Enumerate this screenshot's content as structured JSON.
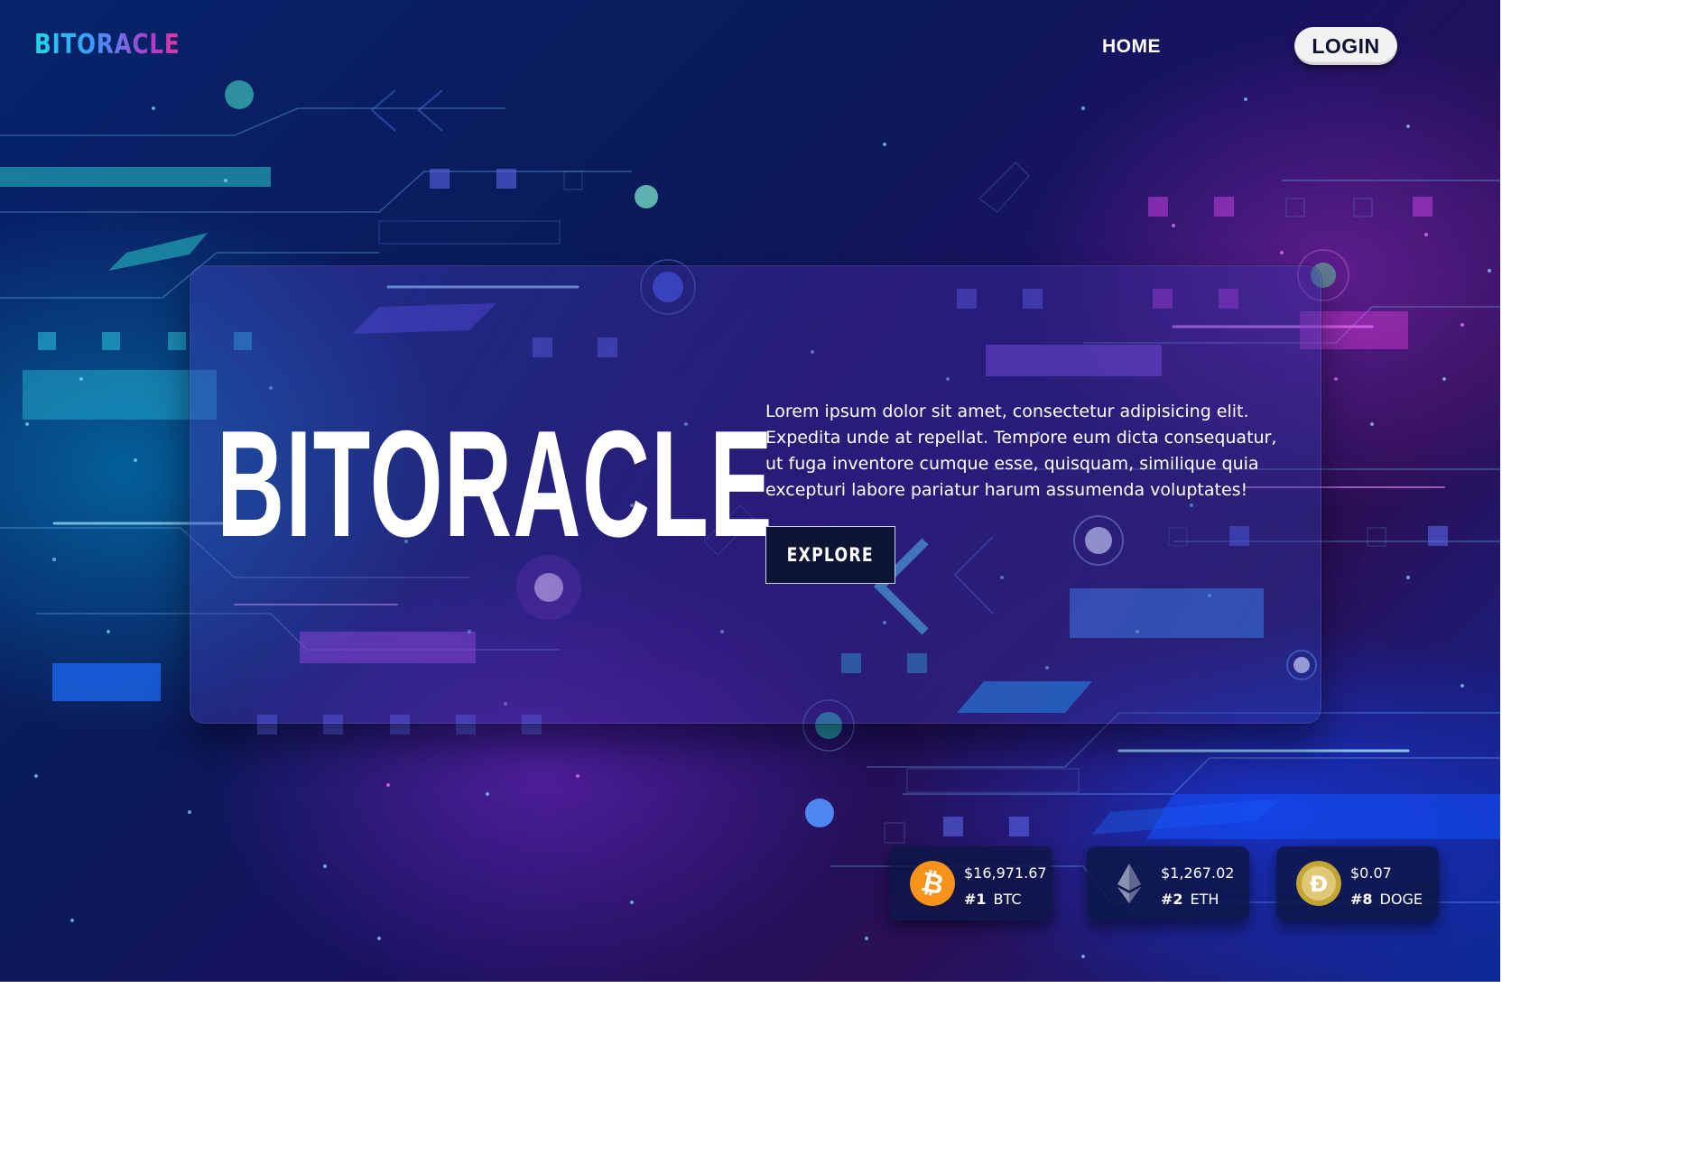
{
  "nav": {
    "brand": "BITORACLE",
    "home_label": "HOME",
    "login_label": "LOGIN"
  },
  "hero": {
    "title": "BITORACLE",
    "description": "Lorem ipsum dolor sit amet, consectetur adipisicing elit. Expedita unde at repellat. Tempore eum dicta consequatur, ut fuga inventore cumque esse, quisquam, similique quia excepturi labore pariatur harum assumenda voluptates!",
    "explore_label": "EXPLORE"
  },
  "coins": [
    {
      "price": "$16,971.67",
      "rank": "#1",
      "symbol": "BTC",
      "icon": "bitcoin-icon",
      "color": "#f7931a"
    },
    {
      "price": "$1,267.02",
      "rank": "#2",
      "symbol": "ETH",
      "icon": "ethereum-icon",
      "color": "#8a92b2"
    },
    {
      "price": "$0.07",
      "rank": "#8",
      "symbol": "DOGE",
      "icon": "dogecoin-icon",
      "color": "#c2a633"
    }
  ],
  "colors": {
    "brand_gradient_start": "#1ed8e6",
    "brand_gradient_end": "#e0389d",
    "background_dark": "#0a1a5a",
    "button_dark": "#0c1534"
  }
}
